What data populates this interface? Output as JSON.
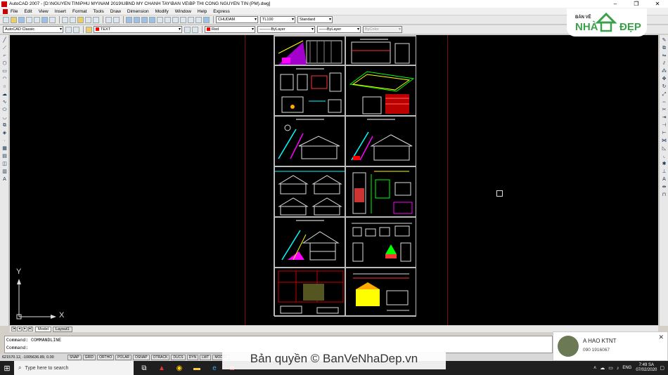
{
  "window": {
    "title": "AutoCAD 2007 - [D:\\NGUYEN TIN\\PHU MY\\NAM 2019\\UBND MY CHANH TAY\\BAN VE\\BP THI CONG NGUYEN TIN (PM).dwg]",
    "controls": [
      "–",
      "❐",
      "✕"
    ]
  },
  "menubar": {
    "items": [
      "File",
      "Edit",
      "View",
      "Insert",
      "Format",
      "Tools",
      "Draw",
      "Dimension",
      "Modify",
      "Window",
      "Help",
      "Express"
    ]
  },
  "toolbar1": {
    "text_style": "CHUDAM",
    "dim_style": "TL100",
    "table_style": "Standard"
  },
  "toolbar2": {
    "workspace": "AutoCAD Classic",
    "layer": "TEXT",
    "color": "Red",
    "linetype": "ByLayer",
    "lineweight": "ByLayer",
    "plotstyle": "ByColor"
  },
  "canvas": {
    "ucs_x": "X",
    "ucs_y": "Y"
  },
  "layout_tabs": [
    "Model",
    "Layout1"
  ],
  "command": {
    "line1": "Command: COMMANDLINE",
    "line2": "Command:"
  },
  "status": {
    "coords": "621570.12, -1005636.89, 0.00",
    "toggles": [
      "SNAP",
      "GRID",
      "ORTHO",
      "POLAR",
      "OSNAP",
      "OTRACK",
      "DUCS",
      "DYN",
      "LWT",
      "MODEL"
    ]
  },
  "taskbar": {
    "search_placeholder": "Type here to search",
    "time": "7:49 SA",
    "date": "07/02/2020",
    "lang": "ENG"
  },
  "watermark": "Bản quyền © BanVeNhaDep.vn",
  "logo": {
    "top": "BẢN VẼ",
    "left": "NHÀ",
    "right": "ĐẸP"
  },
  "notification": {
    "name": "A HAO KTNT",
    "phone": "090 1916067"
  },
  "colors": {
    "canvas": "#000000",
    "sheet_red": "#7a1010",
    "logo_green": "#3aa14a"
  }
}
